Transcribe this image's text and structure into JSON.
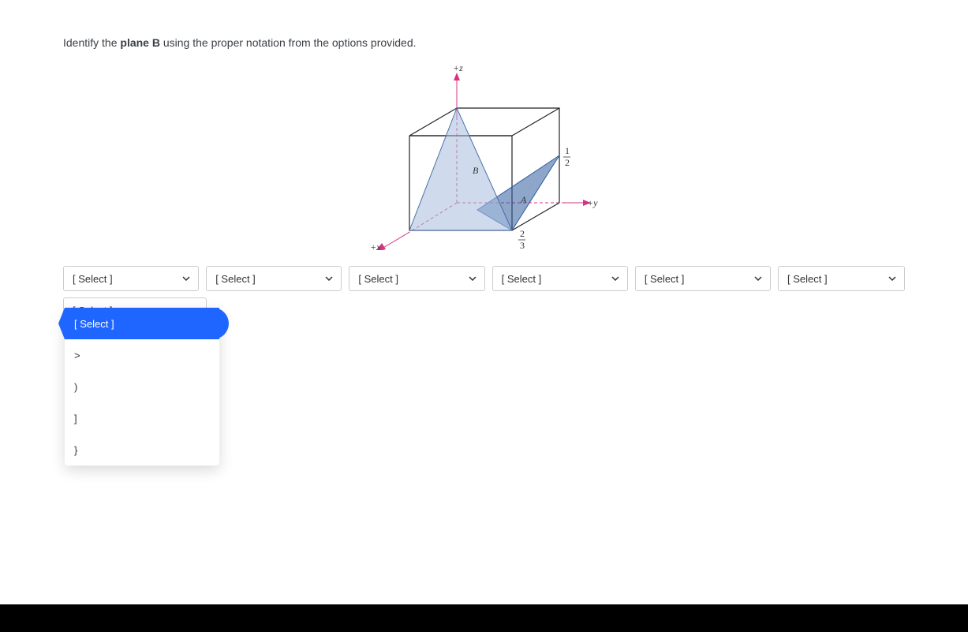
{
  "prompt": {
    "prefix": "Identify the ",
    "bold": "plane B",
    "suffix": " using the proper notation from the options provided."
  },
  "diagram": {
    "axes": {
      "z": "+z",
      "y": "+y",
      "x": "+x"
    },
    "labels": {
      "planeA": "A",
      "planeB": "B",
      "frac12_top": "1",
      "frac12_bot": "2",
      "frac23_top": "2",
      "frac23_bot": "3"
    }
  },
  "selects": [
    {
      "label": "[ Select ]"
    },
    {
      "label": "[ Select ]"
    },
    {
      "label": "[ Select ]"
    },
    {
      "label": "[ Select ]"
    },
    {
      "label": "[ Select ]"
    },
    {
      "label": "[ Select ]"
    }
  ],
  "select_row2": {
    "label": "[ Select ]"
  },
  "dropdown": {
    "selected": "[ Select ]",
    "options": [
      ">",
      ")",
      "]",
      "}"
    ]
  }
}
